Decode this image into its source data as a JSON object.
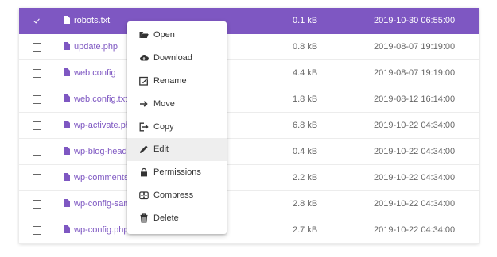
{
  "files": [
    {
      "name": "robots.txt",
      "size": "0.1 kB",
      "date": "2019-10-30 06:55:00",
      "selected": true
    },
    {
      "name": "update.php",
      "size": "0.8 kB",
      "date": "2019-08-07 19:19:00",
      "selected": false
    },
    {
      "name": "web.config",
      "size": "4.4 kB",
      "date": "2019-08-07 19:19:00",
      "selected": false
    },
    {
      "name": "web.config.txt",
      "size": "1.8 kB",
      "date": "2019-08-12 16:14:00",
      "selected": false
    },
    {
      "name": "wp-activate.php",
      "size": "6.8 kB",
      "date": "2019-10-22 04:34:00",
      "selected": false
    },
    {
      "name": "wp-blog-header.php",
      "size": "0.4 kB",
      "date": "2019-10-22 04:34:00",
      "selected": false
    },
    {
      "name": "wp-comments-post.php",
      "size": "2.2 kB",
      "date": "2019-10-22 04:34:00",
      "selected": false
    },
    {
      "name": "wp-config-sample.php",
      "size": "2.8 kB",
      "date": "2019-10-22 04:34:00",
      "selected": false
    },
    {
      "name": "wp-config.php",
      "size": "2.7 kB",
      "date": "2019-10-22 04:34:00",
      "selected": false
    }
  ],
  "context_menu": {
    "items": [
      {
        "label": "Open",
        "icon": "folder-open-icon"
      },
      {
        "label": "Download",
        "icon": "cloud-download-icon"
      },
      {
        "label": "Rename",
        "icon": "rename-icon"
      },
      {
        "label": "Move",
        "icon": "arrow-right-icon"
      },
      {
        "label": "Copy",
        "icon": "copy-icon"
      },
      {
        "label": "Edit",
        "icon": "pencil-icon",
        "active": true
      },
      {
        "label": "Permissions",
        "icon": "lock-icon"
      },
      {
        "label": "Compress",
        "icon": "compress-icon"
      },
      {
        "label": "Delete",
        "icon": "trash-icon"
      }
    ]
  },
  "colors": {
    "accent": "#7e57c2",
    "menu_hover": "#eeeeee"
  }
}
